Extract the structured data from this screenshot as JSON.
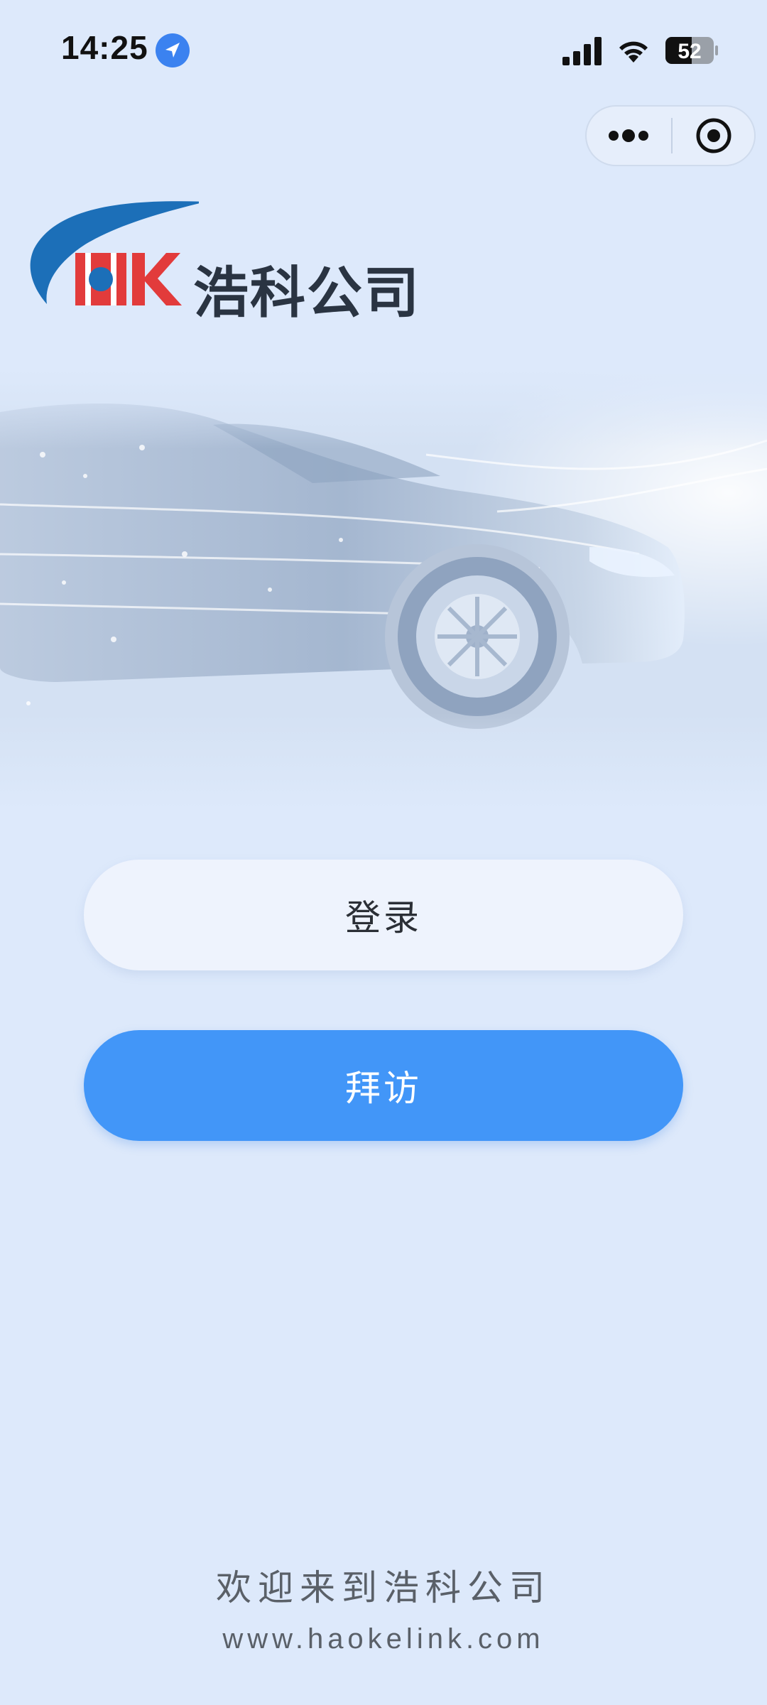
{
  "status_bar": {
    "time": "14:25",
    "battery": "52",
    "icons": [
      "location-arrow-icon",
      "signal-icon",
      "wifi-icon",
      "battery-icon"
    ]
  },
  "capsule": {
    "icons": [
      "more-dots-icon",
      "target-close-icon"
    ]
  },
  "logo": {
    "company_name": "浩科公司",
    "mark": "HK"
  },
  "buttons": {
    "login": "登录",
    "visit": "拜访"
  },
  "footer": {
    "welcome": "欢迎来到浩科公司",
    "url": "www.haokelink.com"
  },
  "colors": {
    "background": "#dde9fb",
    "primary": "#4296f8",
    "login_bg": "#eef3fd",
    "logo_red": "#e23b3b",
    "logo_blue": "#1c6fb8"
  }
}
